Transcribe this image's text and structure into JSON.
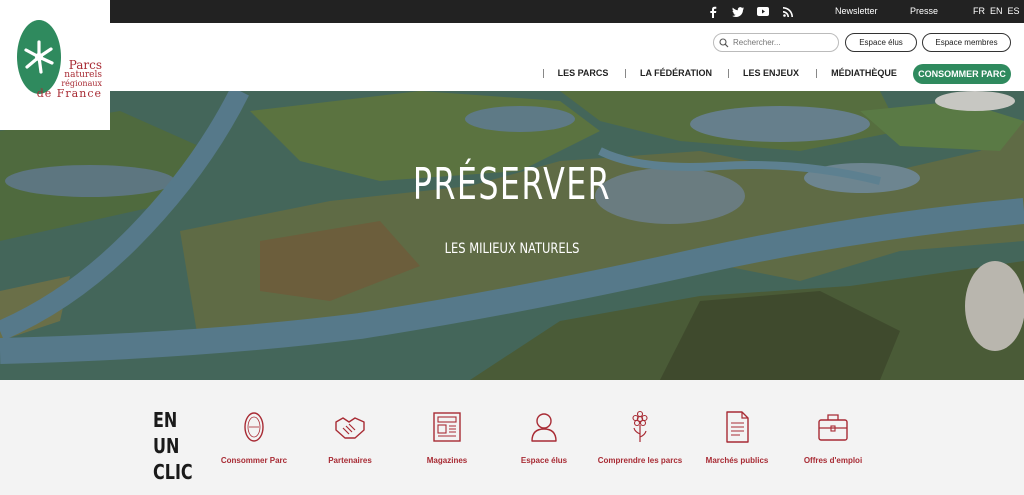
{
  "topbar": {
    "social": [
      "facebook-icon",
      "twitter-icon",
      "youtube-icon",
      "rss-icon"
    ],
    "newsletter": "Newsletter",
    "presse": "Presse",
    "languages": [
      "FR",
      "EN",
      "ES"
    ]
  },
  "logo": {
    "line1": "Parcs",
    "line2": "naturels",
    "line3": "régionaux",
    "line4": "de France"
  },
  "header": {
    "search_placeholder": "Rechercher...",
    "espace_elus": "Espace élus",
    "espace_membres": "Espace membres"
  },
  "nav": {
    "items": [
      "LES PARCS",
      "LA FÉDÉRATION",
      "LES ENJEUX",
      "MÉDIATHÈQUE"
    ],
    "cta": "CONSOMMER PARC"
  },
  "hero": {
    "title": "PRÉSERVER",
    "subtitle": "LES MILIEUX NATURELS"
  },
  "quick": {
    "title": "EN UN CLIC",
    "items": [
      {
        "label": "Consommer Parc",
        "icon": "badge-icon"
      },
      {
        "label": "Partenaires",
        "icon": "handshake-icon"
      },
      {
        "label": "Magazines",
        "icon": "newspaper-icon"
      },
      {
        "label": "Espace élus",
        "icon": "user-icon"
      },
      {
        "label": "Comprendre les parcs",
        "icon": "flower-icon"
      },
      {
        "label": "Marchés publics",
        "icon": "document-icon"
      },
      {
        "label": "Offres d'emploi",
        "icon": "briefcase-icon"
      }
    ]
  },
  "colors": {
    "brand_green": "#2f8a5e",
    "brand_red": "#a82b34",
    "topbar": "#222222"
  }
}
